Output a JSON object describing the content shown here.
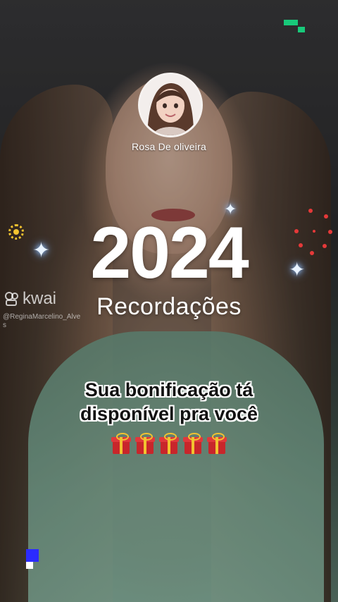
{
  "story": {
    "username": "Rosa De oliveira",
    "year": "2024",
    "subtitle": "Recordações",
    "bonus_line1": "Sua bonificação tá",
    "bonus_line2": "disponível pra você"
  },
  "watermark": {
    "brand": "kwai",
    "handle": "@ReginaMarcelino_Alve s"
  },
  "icons": {
    "gift": "gift-icon",
    "sparkle": "sparkle-icon",
    "sun": "sun-icon",
    "firework": "firework-icon"
  },
  "colors": {
    "text": "#ffffff",
    "bonus_text": "#111111",
    "bonus_outline": "#ffffff",
    "gift_red": "#c8262b",
    "ribbon_gold": "#f2c230",
    "pixel_green": "#18c97a",
    "pixel_blue": "#2b2bff",
    "firework_red": "#e53939"
  }
}
